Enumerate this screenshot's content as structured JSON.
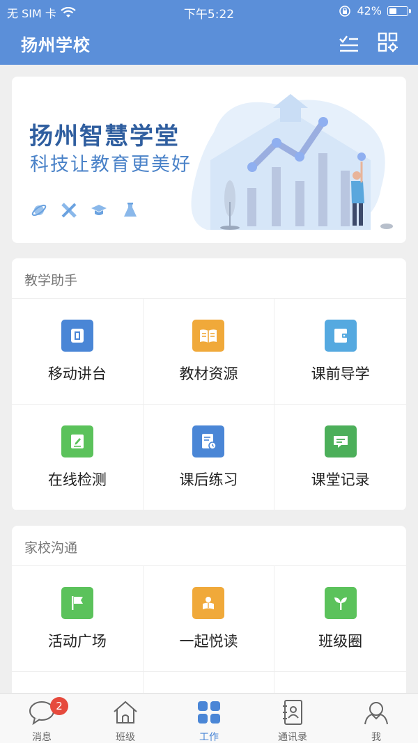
{
  "status": {
    "carrier": "无 SIM 卡",
    "time": "下午5:22",
    "battery": "42%",
    "battery_level": 0.42
  },
  "header": {
    "title": "扬州学校",
    "checklist_icon": "checklist-icon",
    "qr_icon": "qr-grid-icon"
  },
  "banner": {
    "title": "扬州智慧学堂",
    "subtitle": "科技让教育更美好"
  },
  "teaching": {
    "title": "教学助手",
    "items": [
      {
        "label": "移动讲台",
        "icon": "mobile-podium-icon",
        "color": "#4a86d6"
      },
      {
        "label": "教材资源",
        "icon": "book-icon",
        "color": "#f0a93a"
      },
      {
        "label": "课前导学",
        "icon": "wallet-book-icon",
        "color": "#55a9e0"
      },
      {
        "label": "在线检测",
        "icon": "edit-doc-icon",
        "color": "#5bc25b"
      },
      {
        "label": "课后练习",
        "icon": "doc-clock-icon",
        "color": "#4a86d6"
      },
      {
        "label": "课堂记录",
        "icon": "chat-icon",
        "color": "#4caf5a"
      }
    ]
  },
  "homeschool": {
    "title": "家校沟通",
    "items": [
      {
        "label": "活动广场",
        "icon": "flag-icon",
        "color": "#5bc25b"
      },
      {
        "label": "一起悦读",
        "icon": "reader-icon",
        "color": "#f0a93a"
      },
      {
        "label": "班级圈",
        "icon": "sprout-icon",
        "color": "#5bc25b"
      }
    ]
  },
  "tabs": [
    {
      "label": "消息",
      "icon": "message-icon",
      "badge": "2"
    },
    {
      "label": "班级",
      "icon": "home-icon"
    },
    {
      "label": "工作",
      "icon": "apps-grid-icon",
      "active": true
    },
    {
      "label": "通讯录",
      "icon": "contacts-icon"
    },
    {
      "label": "我",
      "icon": "user-icon"
    }
  ],
  "colors": {
    "header": "#5b8fd9",
    "accent": "#4a86d6",
    "badge": "#e64a3d"
  }
}
